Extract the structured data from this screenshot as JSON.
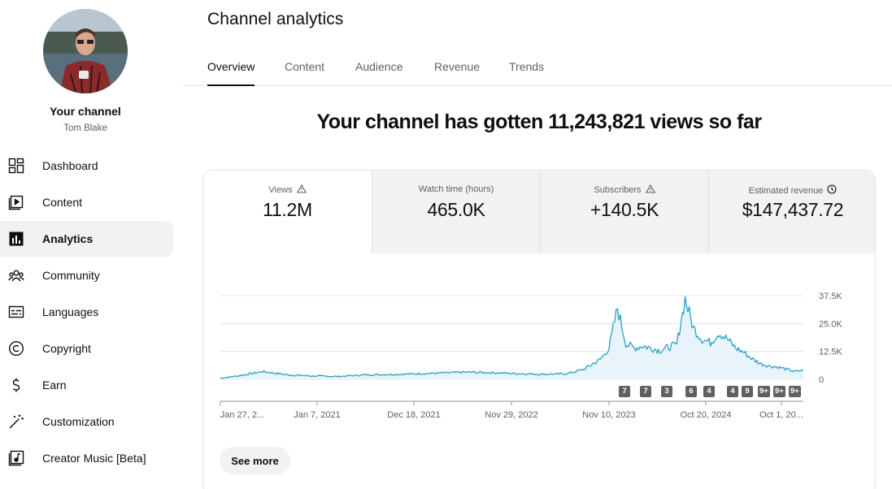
{
  "sidebar": {
    "channel_title": "Your channel",
    "channel_name": "Tom Blake",
    "items": [
      {
        "label": "Dashboard",
        "icon": "dashboard-icon",
        "active": false
      },
      {
        "label": "Content",
        "icon": "content-icon",
        "active": false
      },
      {
        "label": "Analytics",
        "icon": "analytics-icon",
        "active": true
      },
      {
        "label": "Community",
        "icon": "community-icon",
        "active": false
      },
      {
        "label": "Languages",
        "icon": "subtitles-icon",
        "active": false
      },
      {
        "label": "Copyright",
        "icon": "copyright-icon",
        "active": false
      },
      {
        "label": "Earn",
        "icon": "dollar-icon",
        "active": false
      },
      {
        "label": "Customization",
        "icon": "magic-wand-icon",
        "active": false
      },
      {
        "label": "Creator Music [Beta]",
        "icon": "music-icon",
        "active": false
      }
    ]
  },
  "header": {
    "title": "Channel analytics",
    "tabs": [
      {
        "label": "Overview",
        "active": true
      },
      {
        "label": "Content",
        "active": false
      },
      {
        "label": "Audience",
        "active": false
      },
      {
        "label": "Revenue",
        "active": false
      },
      {
        "label": "Trends",
        "active": false
      }
    ]
  },
  "headline": "Your channel has gotten 11,243,821 views so far",
  "metrics": [
    {
      "label": "Views",
      "value": "11.2M",
      "icon": "warning-icon",
      "active": true
    },
    {
      "label": "Watch time (hours)",
      "value": "465.0K",
      "icon": "",
      "active": false
    },
    {
      "label": "Subscribers",
      "value": "+140.5K",
      "icon": "warning-icon",
      "active": false
    },
    {
      "label": "Estimated revenue",
      "value": "$147,437.72",
      "icon": "clock-icon",
      "active": false
    }
  ],
  "chart_data": {
    "type": "area",
    "y_tick_labels": [
      "0",
      "12.5K",
      "25.0K",
      "37.5K"
    ],
    "y_ticks": [
      0,
      12500,
      25000,
      37500
    ],
    "ylim": [
      0,
      37500
    ],
    "x_tick_labels": [
      "Jan 27, 2...",
      "Jan 7, 2021",
      "Dec 18, 2021",
      "Nov 29, 2022",
      "Nov 10, 2023",
      "Oct 20, 2024",
      "Oct 1, 20..."
    ],
    "x": [
      "2020-01",
      "2020-03",
      "2020-06",
      "2020-09",
      "2020-12",
      "2021-03",
      "2021-06",
      "2021-09",
      "2021-12",
      "2022-03",
      "2022-06",
      "2022-09",
      "2022-12",
      "2023-03",
      "2023-06",
      "2023-08",
      "2023-10",
      "2023-11",
      "2023-12",
      "2024-01",
      "2024-02",
      "2024-03",
      "2024-05",
      "2024-07",
      "2024-08",
      "2024-09",
      "2024-10",
      "2024-11",
      "2024-12",
      "2025-01",
      "2025-02",
      "2025-03",
      "2025-04",
      "2025-05",
      "2025-06",
      "2025-07",
      "2025-08",
      "2025-09",
      "2025-10"
    ],
    "values": [
      500,
      1500,
      3500,
      2000,
      1500,
      1300,
      2000,
      2200,
      2500,
      2800,
      3200,
      3000,
      2600,
      2300,
      2500,
      4500,
      9000,
      14000,
      32000,
      16000,
      14000,
      15000,
      13000,
      15500,
      36000,
      23000,
      18000,
      16500,
      21000,
      18000,
      14000,
      12000,
      9000,
      7000,
      6000,
      5500,
      4500,
      3500,
      4000
    ],
    "grid": true,
    "annotations": [
      "7",
      "7",
      "3",
      "6",
      "4",
      "4",
      "9",
      "9+",
      "9+",
      "9+"
    ],
    "color": "#2ba1c6"
  },
  "see_more_label": "See more"
}
